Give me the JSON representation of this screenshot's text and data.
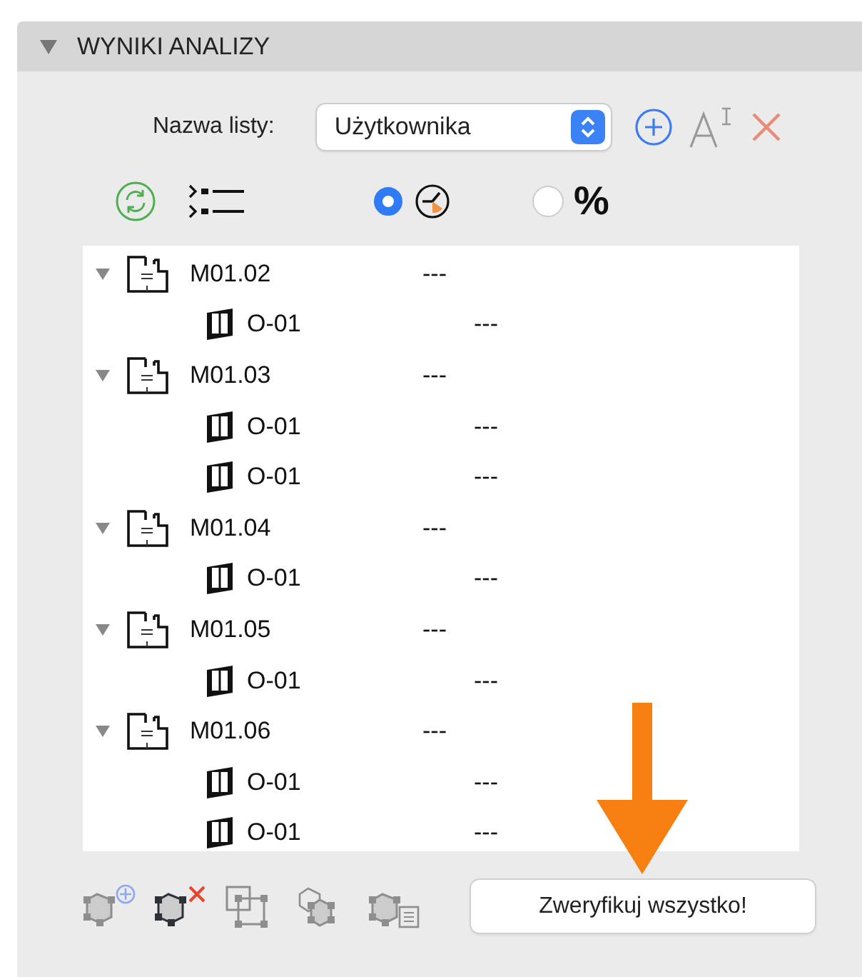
{
  "panel": {
    "title": "WYNIKI ANALIZY",
    "expanded": true
  },
  "list_name": {
    "label": "Nazwa listy:",
    "value": "Użytkownika"
  },
  "display_modes": [
    {
      "kind": "time",
      "selected": true
    },
    {
      "kind": "percent",
      "label": "%",
      "selected": false
    }
  ],
  "tree": [
    {
      "name": "M01.02",
      "value": "---",
      "expanded": true,
      "children": [
        {
          "name": "O-01",
          "value": "---"
        }
      ]
    },
    {
      "name": "M01.03",
      "value": "---",
      "expanded": true,
      "children": [
        {
          "name": "O-01",
          "value": "---"
        },
        {
          "name": "O-01",
          "value": "---"
        }
      ]
    },
    {
      "name": "M01.04",
      "value": "---",
      "expanded": true,
      "children": [
        {
          "name": "O-01",
          "value": "---"
        }
      ]
    },
    {
      "name": "M01.05",
      "value": "---",
      "expanded": true,
      "children": [
        {
          "name": "O-01",
          "value": "---"
        }
      ]
    },
    {
      "name": "M01.06",
      "value": "---",
      "expanded": true,
      "children": [
        {
          "name": "O-01",
          "value": "---"
        },
        {
          "name": "O-01",
          "value": "---"
        }
      ]
    }
  ],
  "toolbar": [
    {
      "kind": "add",
      "disabled": true
    },
    {
      "kind": "remove",
      "disabled": false
    },
    {
      "kind": "frame",
      "disabled": true
    },
    {
      "kind": "stack",
      "disabled": true
    },
    {
      "kind": "list",
      "disabled": true
    }
  ],
  "verify_button": "Zweryfikuj wszystko!"
}
